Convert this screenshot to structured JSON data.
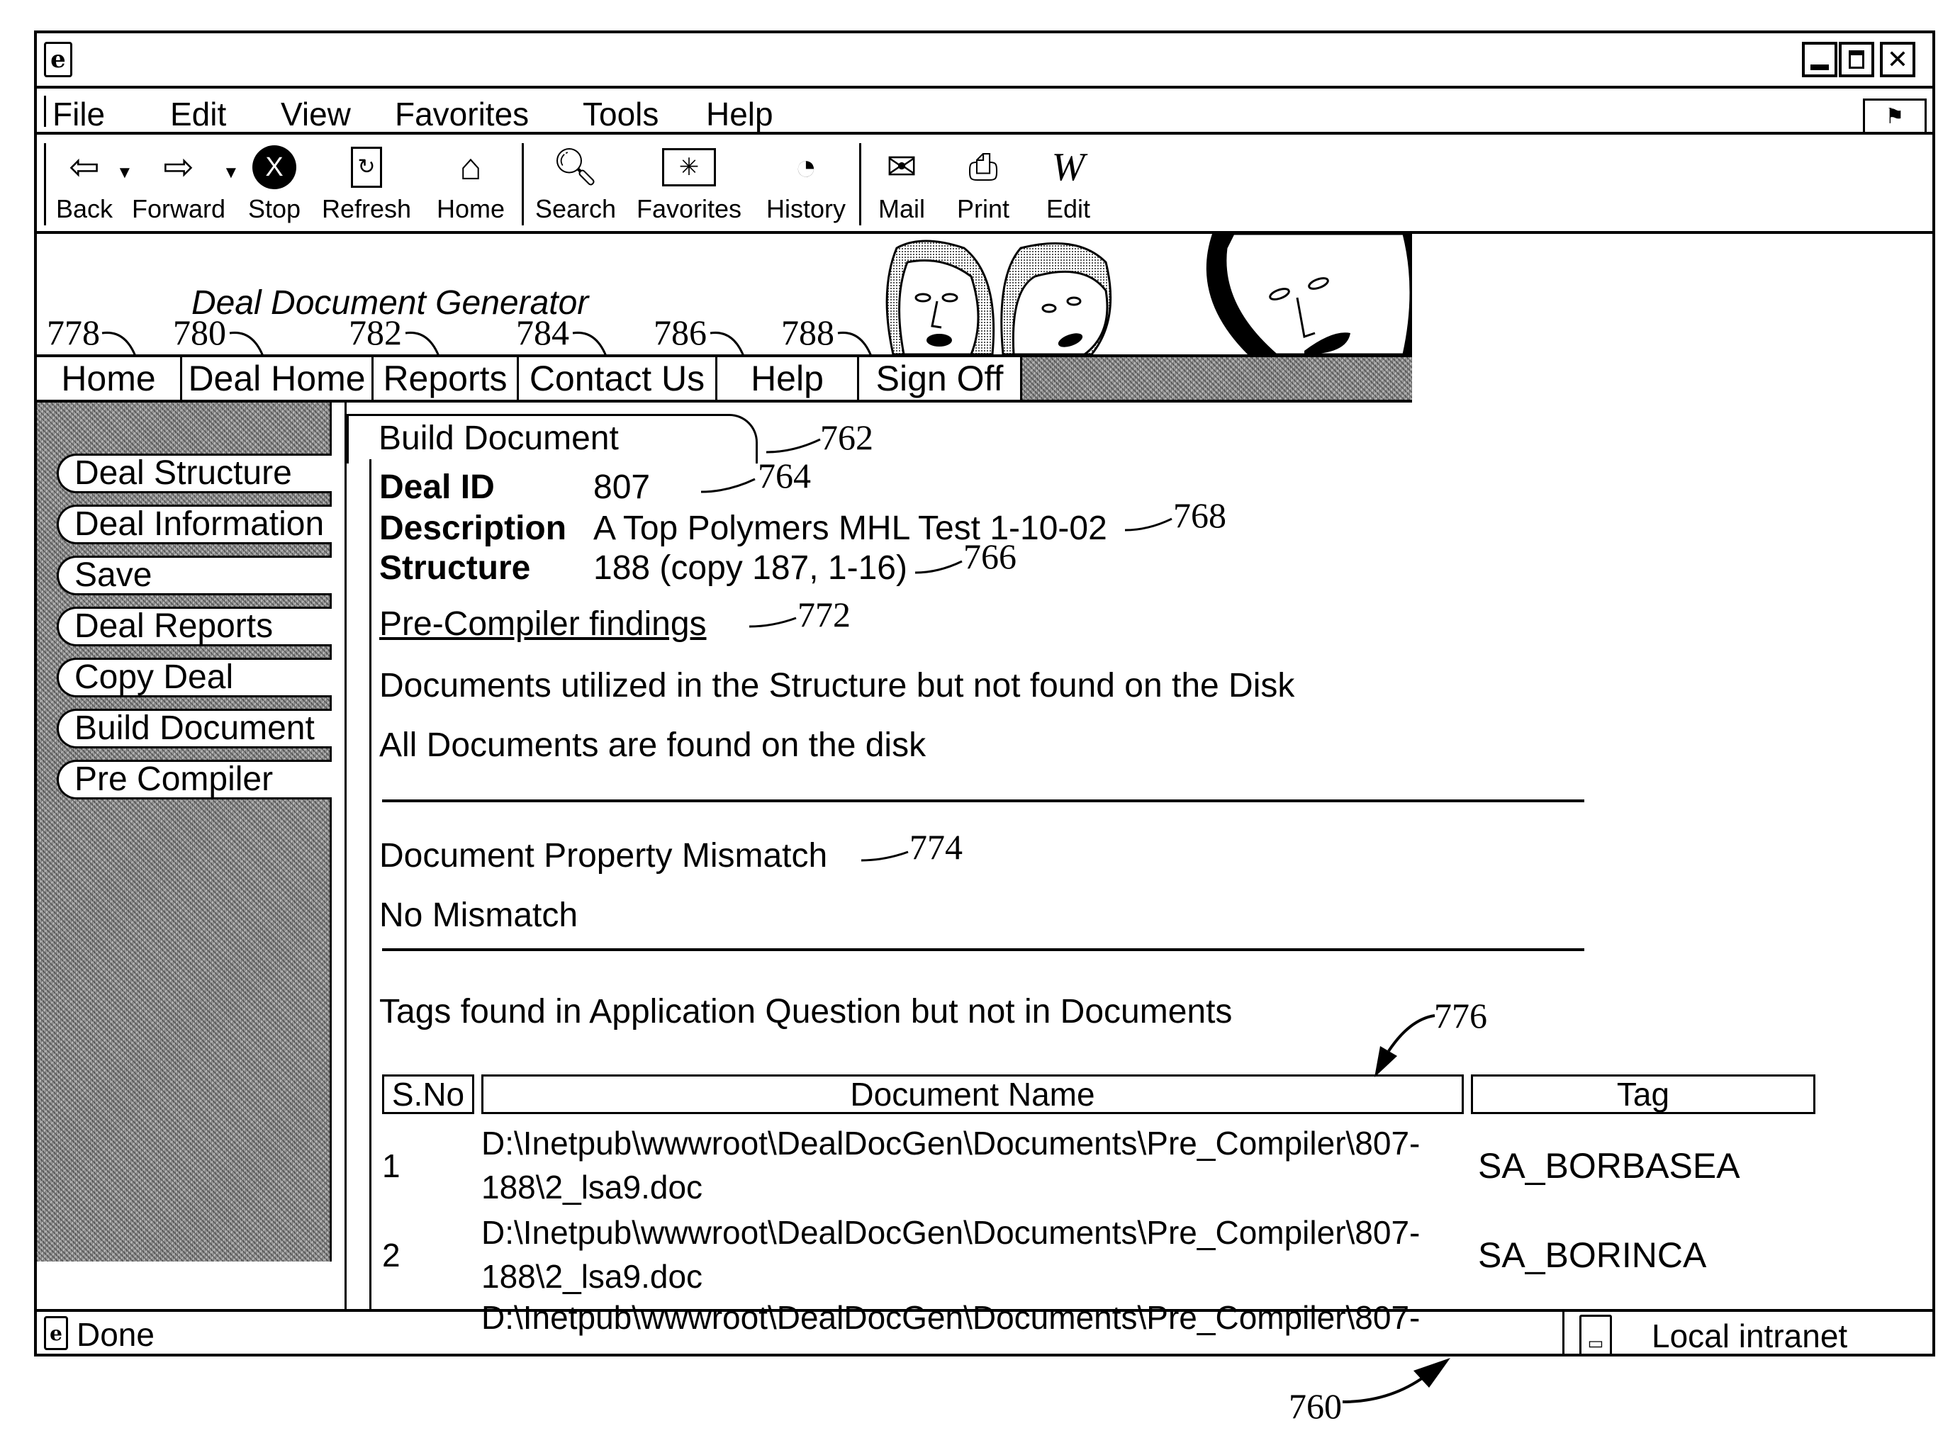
{
  "window": {
    "title_icon": "ie-logo-icon",
    "controls": [
      "minimize",
      "restore",
      "close"
    ]
  },
  "menu": {
    "items": [
      {
        "label": "File",
        "accel": "F"
      },
      {
        "label": "Edit",
        "accel": "E"
      },
      {
        "label": "View",
        "accel": "V"
      },
      {
        "label": "Favorites",
        "accel": "a"
      },
      {
        "label": "Tools",
        "accel": "T"
      },
      {
        "label": "Help",
        "accel": "H"
      }
    ]
  },
  "toolbar": {
    "buttons": [
      {
        "label": "Back",
        "icon": "back-arrow-icon"
      },
      {
        "label": "Forward",
        "icon": "forward-arrow-icon"
      },
      {
        "label": "Stop",
        "icon": "stop-icon"
      },
      {
        "label": "Refresh",
        "icon": "refresh-icon"
      },
      {
        "label": "Home",
        "icon": "home-icon"
      },
      {
        "label": "Search",
        "icon": "search-icon"
      },
      {
        "label": "Favorites",
        "icon": "favorites-icon"
      },
      {
        "label": "History",
        "icon": "history-icon"
      },
      {
        "label": "Mail",
        "icon": "mail-icon"
      },
      {
        "label": "Print",
        "icon": "print-icon"
      },
      {
        "label": "Edit",
        "icon": "edit-icon"
      }
    ]
  },
  "banner": {
    "title": "Deal Document Generator",
    "nav": [
      {
        "label": "Home",
        "ref": "778"
      },
      {
        "label": "Deal Home",
        "ref": "780"
      },
      {
        "label": "Reports",
        "ref": "782"
      },
      {
        "label": "Contact Us",
        "ref": "784"
      },
      {
        "label": "Help",
        "ref": "786"
      },
      {
        "label": "Sign Off",
        "ref": "788"
      }
    ]
  },
  "sidebar": {
    "items": [
      {
        "label": "Deal Structure"
      },
      {
        "label": "Deal Information"
      },
      {
        "label": "Save"
      },
      {
        "label": "Deal Reports"
      },
      {
        "label": "Copy Deal"
      },
      {
        "label": "Build Document"
      },
      {
        "label": "Pre Compiler"
      }
    ]
  },
  "main": {
    "tab_label": "Build Document",
    "tab_ref": "762",
    "fields": [
      {
        "label": "Deal ID",
        "value": "807",
        "ref": "764"
      },
      {
        "label": "Description",
        "value": "A Top Polymers MHL Test 1-10-02",
        "ref": "768"
      },
      {
        "label": "Structure",
        "value": "188 (copy 187, 1-16)",
        "ref": "766"
      }
    ],
    "findings_link": "Pre-Compiler findings",
    "findings_ref": "772",
    "section1_heading": "Documents utilized in the Structure but not found on the Disk",
    "section1_result": "All Documents are found on the disk",
    "section2_heading": "Document Property Mismatch",
    "section2_ref": "774",
    "section2_result": "No Mismatch",
    "section3_heading": "Tags found in Application Question but not in Documents",
    "table_ref": "776",
    "table": {
      "columns": [
        "S.No",
        "Document Name",
        "Tag"
      ],
      "rows": [
        {
          "sno": "1",
          "doc_line1": "D:\\Inetpub\\wwwroot\\DealDocGen\\Documents\\Pre_Compiler\\807-",
          "doc_line2": "188\\2_lsa9.doc",
          "tag": "SA_BORBASEA"
        },
        {
          "sno": "2",
          "doc_line1": "D:\\Inetpub\\wwwroot\\DealDocGen\\Documents\\Pre_Compiler\\807-",
          "doc_line2": "188\\2_lsa9.doc",
          "tag": "SA_BORINCA"
        },
        {
          "sno": "",
          "doc_line1": "D:\\Inetpub\\wwwroot\\DealDocGen\\Documents\\Pre_Compiler\\807-",
          "doc_line2": "",
          "tag": ""
        }
      ]
    }
  },
  "status": {
    "text": "Done",
    "zone": "Local intranet"
  },
  "figure_ref": "760"
}
